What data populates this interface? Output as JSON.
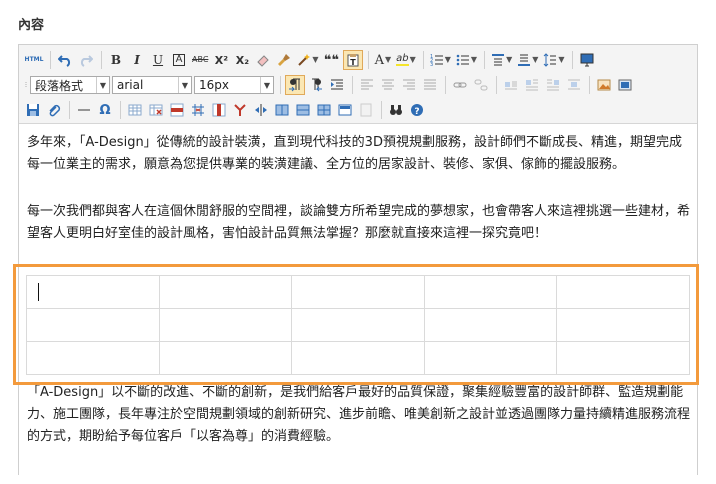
{
  "section": {
    "title": "內容"
  },
  "toolbar": {
    "row1": {
      "html_label": "HTML",
      "bold": "B",
      "italic": "I",
      "underline": "U",
      "boxed_a": "A",
      "strike": "ABC",
      "superscript": "X²",
      "subscript": "X₂",
      "quote": "❝❝",
      "font_color": "A",
      "highlight": "ab"
    },
    "row2": {
      "paragraph_format": "段落格式",
      "font_family": "arial",
      "font_size": "16px"
    },
    "row3": {
      "omega": "Ω"
    }
  },
  "content": {
    "paragraphs": [
      "多年來，「A-Design」從傳統的設計裝潢，直到現代科技的3D預視規劃服務，設計師們不斷成長、精進，期望完成每一位業主的需求，願意為您提供專業的裝潢建議、全方位的居家設計、裝修、家俱、傢飾的擺設服務。",
      "每一次我們都與客人在這個休閒舒服的空間裡，談論雙方所希望完成的夢想家，也會帶客人來這裡挑選一些建材，希望客人更明白好室佳的設計風格，害怕設計品質無法掌握？那麼就直接來這裡一探究竟吧！",
      "「A-Design」以不斷的改進、不斷的創新，是我們給客戶最好的品質保證，聚集經驗豐富的設計師群、監造規劃能力、施工團隊，長年專注於空間規劃領域的創新研究、進步前瞻、唯美創新之設計並透過團隊力量持續精進服務流程的方式，期盼給予每位客戶「以客為尊」的消費經驗。"
    ],
    "table": {
      "rows": 3,
      "cols": 5
    }
  },
  "colors": {
    "highlight_border": "#f39a3c",
    "icon_blue": "#2f6db5",
    "icon_red": "#c0392b"
  }
}
